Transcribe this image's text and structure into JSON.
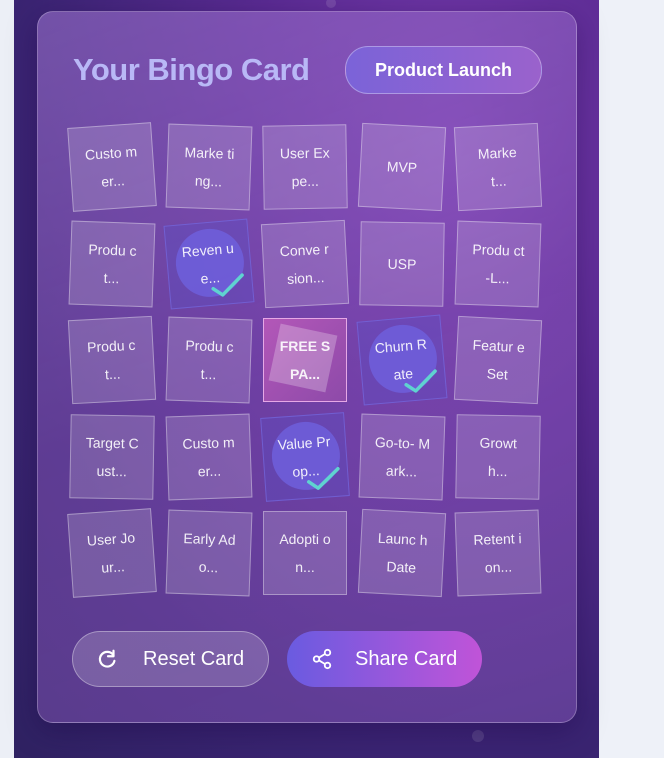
{
  "header": {
    "title": "Your Bingo Card",
    "theme": "Product Launch"
  },
  "grid": {
    "cells": [
      {
        "label": "Custo mer...",
        "marked": false
      },
      {
        "label": "Marke ting...",
        "marked": false
      },
      {
        "label": "User Expe...",
        "marked": false
      },
      {
        "label": "MVP",
        "marked": false
      },
      {
        "label": "Marke t...",
        "marked": false
      },
      {
        "label": "Produ ct...",
        "marked": false
      },
      {
        "label": "Reven ue...",
        "marked": true
      },
      {
        "label": "Conve rsion...",
        "marked": false
      },
      {
        "label": "USP",
        "marked": false
      },
      {
        "label": "Produ ct-L...",
        "marked": false
      },
      {
        "label": "Produ ct...",
        "marked": false
      },
      {
        "label": "Produ ct...",
        "marked": false
      },
      {
        "label": "FREE SPA...",
        "marked": false,
        "free": true
      },
      {
        "label": "Churn Rate",
        "marked": true
      },
      {
        "label": "Featur e Set",
        "marked": false
      },
      {
        "label": "Target Cust...",
        "marked": false
      },
      {
        "label": "Custo mer...",
        "marked": false
      },
      {
        "label": "Value Prop...",
        "marked": true
      },
      {
        "label": "Go-to- Mark...",
        "marked": false
      },
      {
        "label": "Growt h...",
        "marked": false
      },
      {
        "label": "User Jour...",
        "marked": false
      },
      {
        "label": "Early Ado...",
        "marked": false
      },
      {
        "label": "Adopti on...",
        "marked": false
      },
      {
        "label": "Launc h Date",
        "marked": false
      },
      {
        "label": "Retent ion...",
        "marked": false
      }
    ]
  },
  "actions": {
    "reset_label": "Reset Card",
    "share_label": "Share Card"
  },
  "colors": {
    "accent": "#7b63d8",
    "check": "#5fd3d0",
    "free_cell": "#b357b8"
  }
}
